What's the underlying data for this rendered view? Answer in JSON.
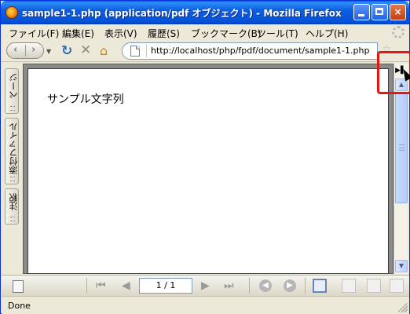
{
  "window": {
    "title": "sample1-1.php (application/pdf オブジェクト) - Mozilla Firefox",
    "min_label": "",
    "max_label": "",
    "close_label": "×"
  },
  "menu": {
    "items": [
      {
        "label": "ファイル(F)"
      },
      {
        "label": "編集(E)"
      },
      {
        "label": "表示(V)"
      },
      {
        "label": "履歴(S)"
      },
      {
        "label": "ブックマーク(B)"
      },
      {
        "label": "ツール(T)"
      },
      {
        "label": "ヘルプ(H)"
      }
    ]
  },
  "nav": {
    "back_glyph": "‹",
    "forward_glyph": "›",
    "dropdown_glyph": "▼",
    "reload_glyph": "↻",
    "stop_glyph": "✕",
    "home_glyph": "⌂",
    "url": "http://localhost/php/fpdf/document/sample1-1.php",
    "bookmark_star": "☆"
  },
  "side_panel": {
    "tabs": [
      {
        "label": "ページ"
      },
      {
        "label": "添付ファイル"
      },
      {
        "label": "注釈"
      }
    ]
  },
  "document": {
    "text": "サンプル文字列"
  },
  "scrollbar": {
    "up_arrow": "▲",
    "down_arrow": "▼",
    "nav_pane_toggle": "▶▌"
  },
  "pdf_toolbar": {
    "first_page_glyph": "⏮",
    "prev_page_glyph": "◀",
    "page_indicator": "1 / 1",
    "next_page_glyph": "▶",
    "last_page_glyph": "⏭",
    "back_view_glyph": "◀",
    "forward_view_glyph": "▶"
  },
  "status": {
    "text": "Done"
  },
  "colors": {
    "titlebar": "#0553d8",
    "highlight": "#e81515",
    "chrome": "#ece9d8"
  }
}
